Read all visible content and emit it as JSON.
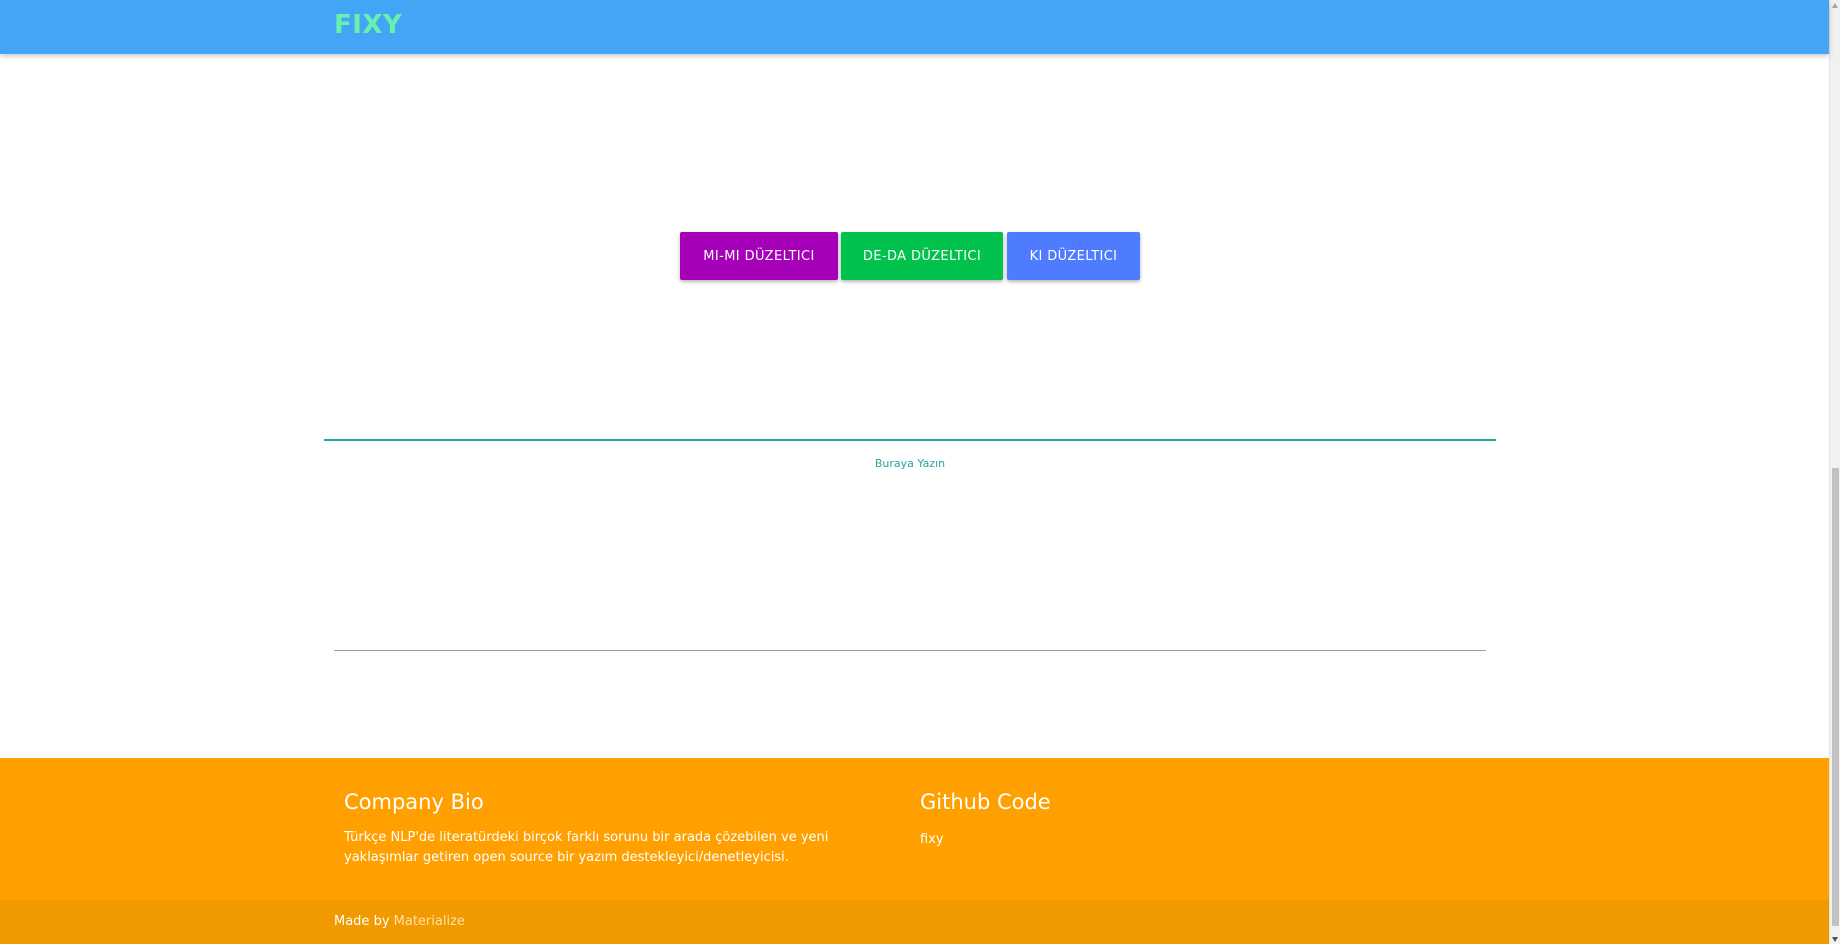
{
  "navbar": {
    "brand": "FIXY"
  },
  "actions": {
    "mimi_label": "MI-MI DÜZELTICI",
    "deda_label": "DE-DA DÜZELTICI",
    "ki_label": "KI DÜZELTICI"
  },
  "editor": {
    "label": "Buraya Yazın"
  },
  "footer": {
    "bio_title": "Company Bio",
    "bio_text": "Türkçe NLP'de literatürdeki birçok farklı sorunu bir arada çözebilen ve yeni yaklaşımlar getiren open source bir yazım destekleyici/denetleyicisi.",
    "github_title": "Github Code",
    "github_link": "fixy"
  },
  "copyright": {
    "made_by": "Made by",
    "made_by_link": "Materialize"
  },
  "colors": {
    "navbar": "#42a5f5",
    "brand": "#69f0ae",
    "mimi": "#a600b8",
    "deda": "#00c24d",
    "ki": "#4f7bff",
    "accent": "#26a69a",
    "footer": "#ffa000",
    "footer_copyright": "#f09a00"
  }
}
